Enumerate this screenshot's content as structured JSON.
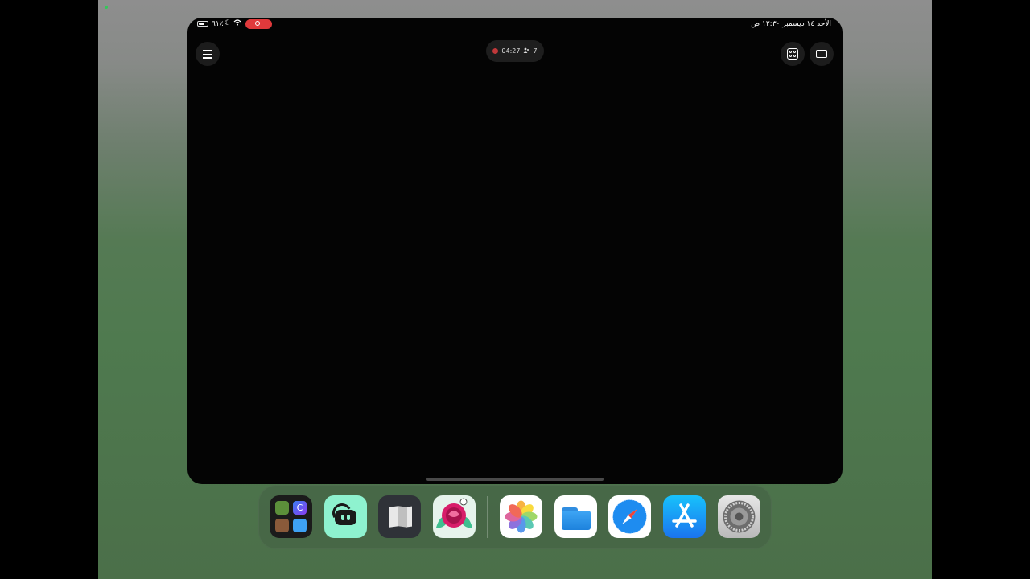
{
  "status_bar": {
    "battery_percent": "٦١٪",
    "datetime": "الأحد ١٤ ديسمبر ١٢:٣٠ ص"
  },
  "recording_pill": {
    "elapsed": "04:27",
    "viewers": "7"
  },
  "dock": {
    "apps": [
      {
        "name": "app-folder",
        "icon": "folder-icon"
      },
      {
        "name": "steam-link",
        "icon": "controller-link-icon"
      },
      {
        "name": "maps",
        "icon": "map-icon"
      },
      {
        "name": "coloring-game",
        "icon": "flower-icon"
      },
      {
        "name": "photos",
        "icon": "photos-icon"
      },
      {
        "name": "files",
        "icon": "folder-blue-icon"
      },
      {
        "name": "safari",
        "icon": "compass-icon"
      },
      {
        "name": "app-store",
        "icon": "app-store-icon"
      },
      {
        "name": "settings",
        "icon": "gear-icon"
      }
    ]
  },
  "colors": {
    "recording_red": "#e0393b",
    "steam_link_mint": "#8ef2cf",
    "appstore_blue": "#1a74ef"
  }
}
